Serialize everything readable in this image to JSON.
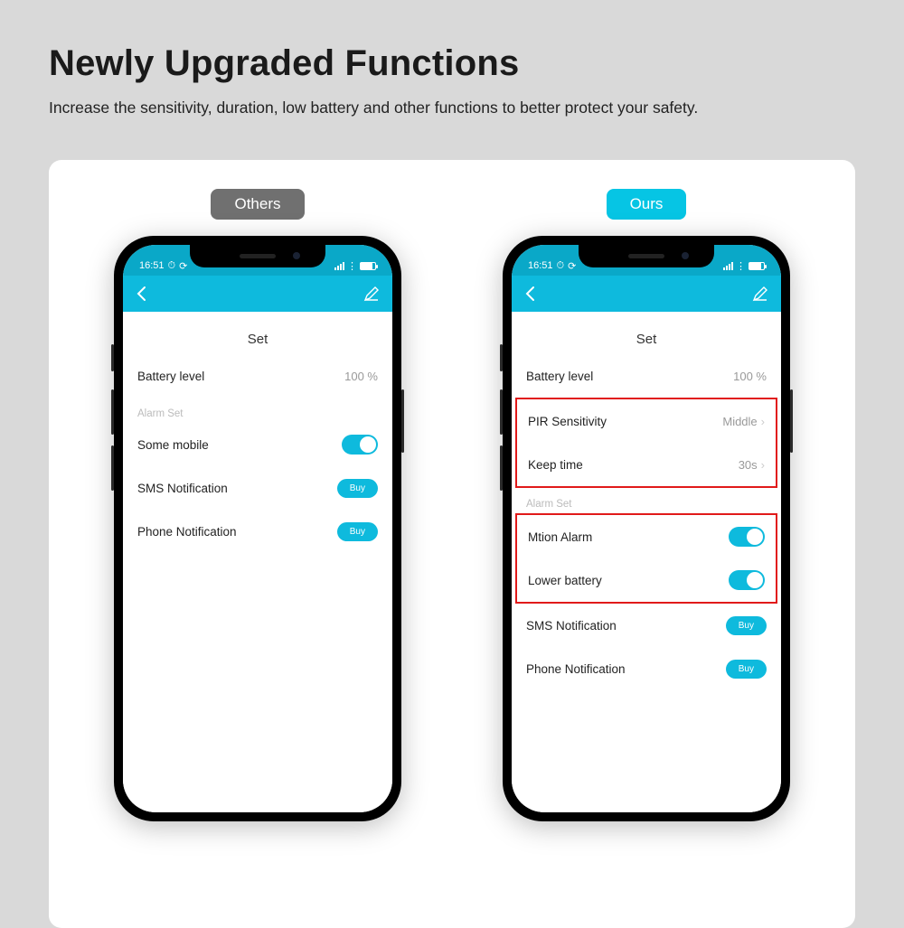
{
  "page": {
    "title": "Newly Upgraded Functions",
    "subtitle": "Increase the sensitivity, duration, low battery and other functions to better protect your safety."
  },
  "tags": {
    "others": "Others",
    "ours": "Ours"
  },
  "status": {
    "time": "16:51"
  },
  "app": {
    "set_title": "Set",
    "battery_label": "Battery level",
    "battery_value": "100 %",
    "alarm_set_label": "Alarm Set",
    "some_mobile": "Some mobile",
    "sms_notification": "SMS Notification",
    "phone_notification": "Phone Notification",
    "buy": "Buy",
    "pir_sensitivity_label": "PIR Sensitivity",
    "pir_sensitivity_value": "Middle",
    "keep_time_label": "Keep time",
    "keep_time_value": "30s",
    "motion_alarm": "Mtion Alarm",
    "lower_battery": "Lower battery"
  }
}
